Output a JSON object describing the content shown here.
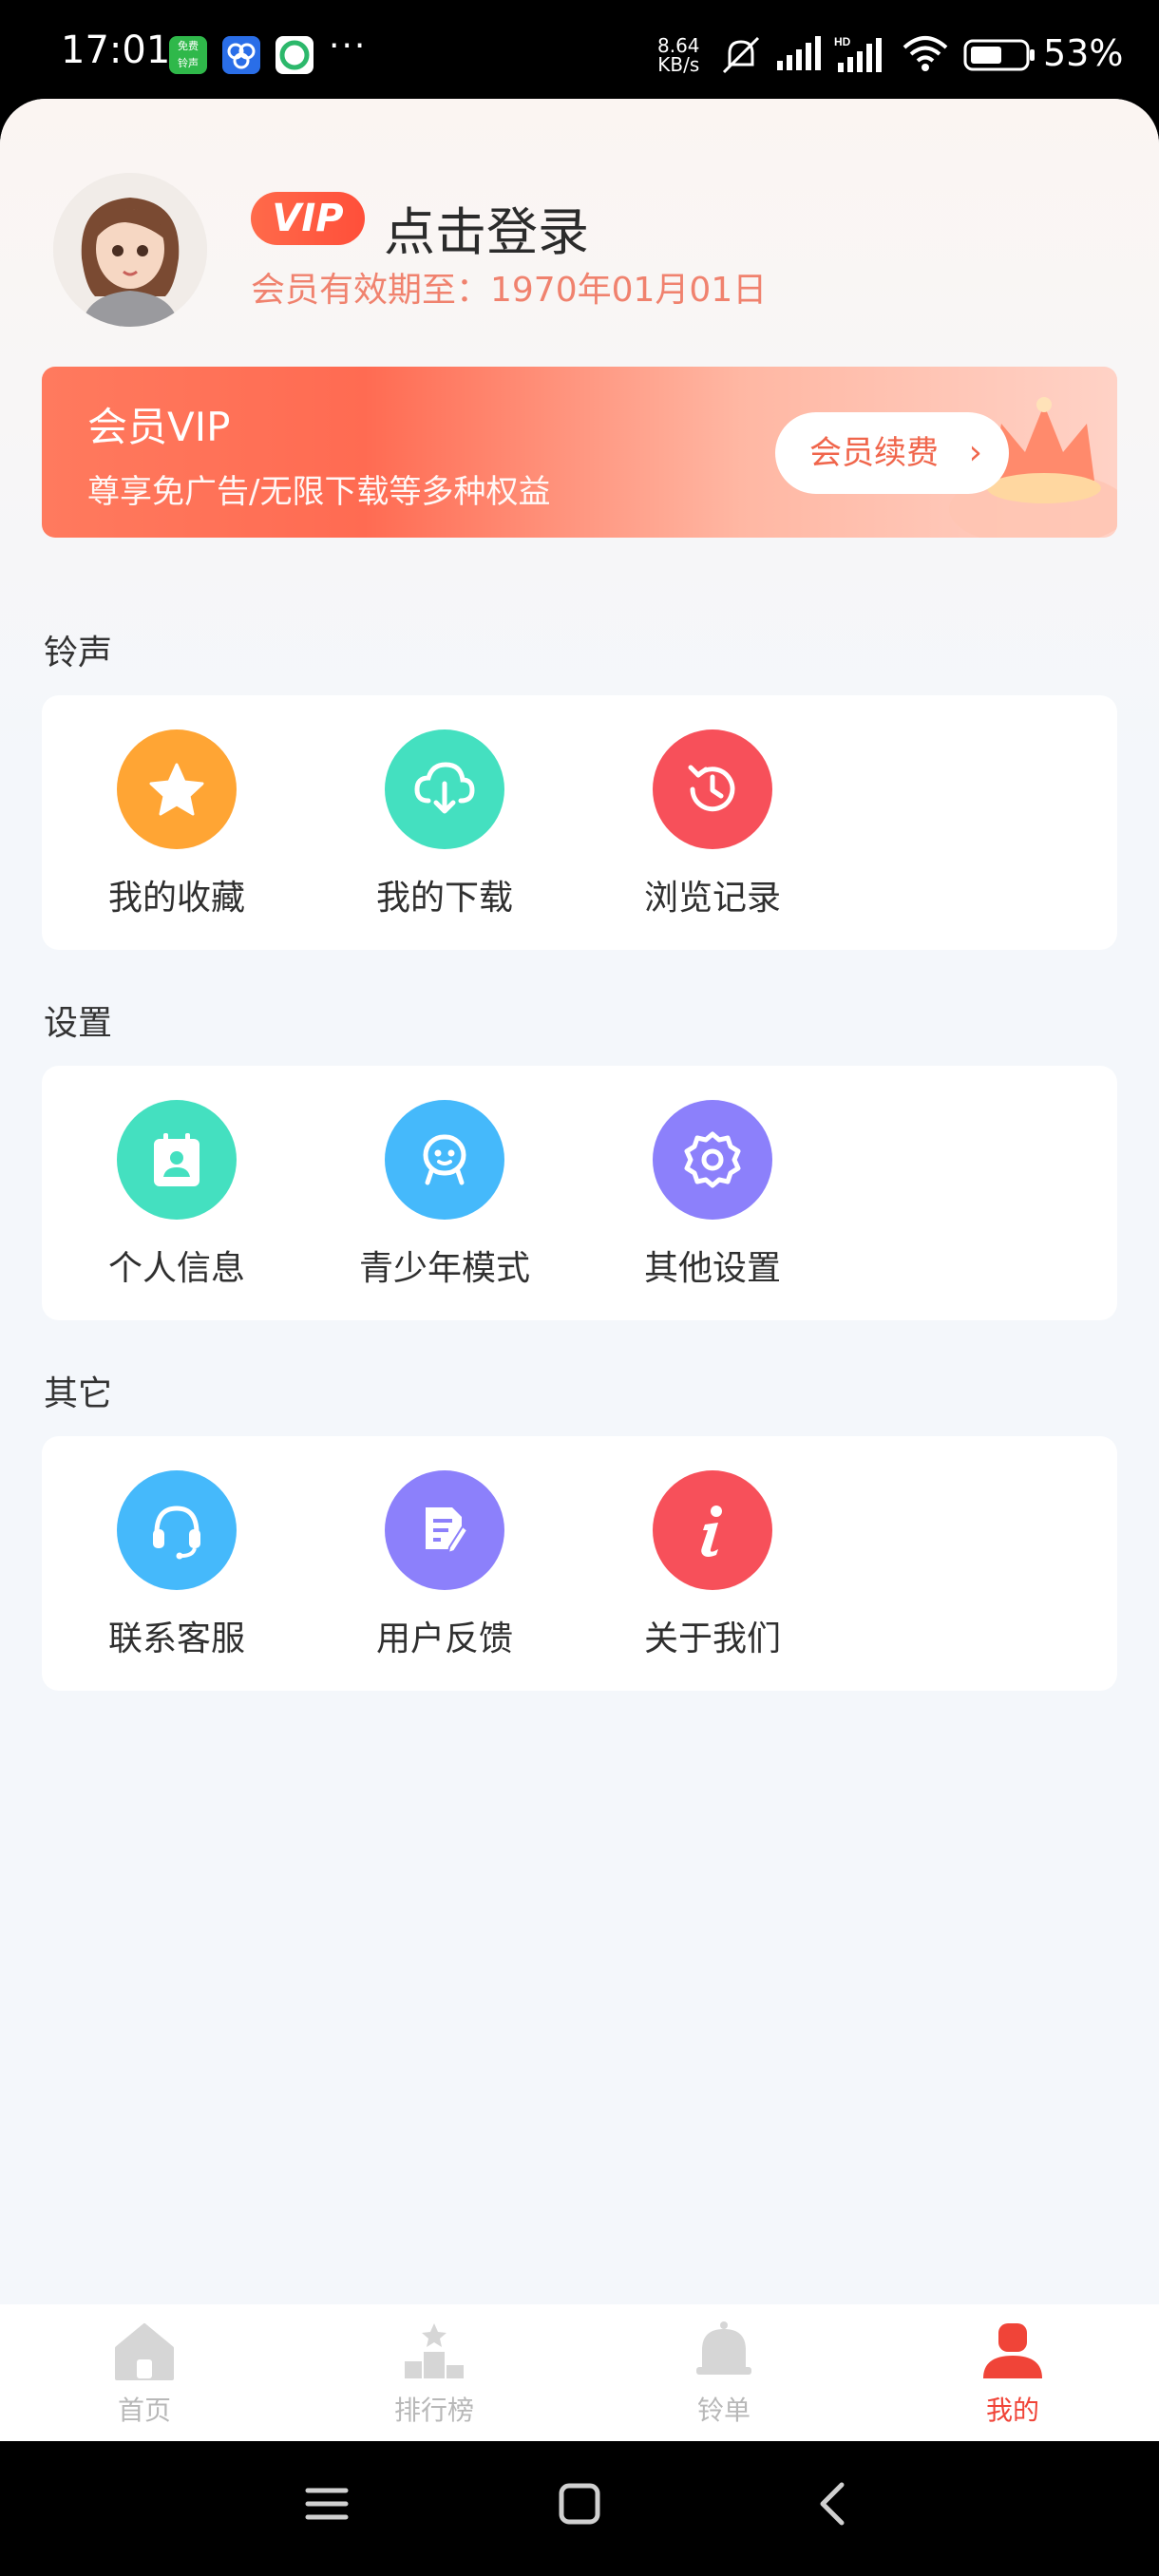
{
  "status_bar": {
    "time": "17:01",
    "app_badge_text": "免费\n铃声",
    "more": "···",
    "net_speed_value": "8.64",
    "net_speed_unit": "KB/s",
    "battery": "53%"
  },
  "profile": {
    "vip_badge": "VIP",
    "login_text": "点击登录",
    "member_expire": "会员有效期至：1970年01月01日"
  },
  "vip_card": {
    "title": "会员VIP",
    "subtitle": "尊享免广告/无限下载等多种权益",
    "renew_button": "会员续费"
  },
  "sections": [
    {
      "title": "铃声",
      "items": [
        {
          "label": "我的收藏",
          "icon": "star-icon",
          "color": "#ffa534"
        },
        {
          "label": "我的下载",
          "icon": "cloud-download-icon",
          "color": "#44e0c0"
        },
        {
          "label": "浏览记录",
          "icon": "history-icon",
          "color": "#f7505a"
        }
      ]
    },
    {
      "title": "设置",
      "items": [
        {
          "label": "个人信息",
          "icon": "contact-card-icon",
          "color": "#44e0c0"
        },
        {
          "label": "青少年模式",
          "icon": "smile-face-icon",
          "color": "#45b9fb"
        },
        {
          "label": "其他设置",
          "icon": "gear-icon",
          "color": "#8c80fb"
        }
      ]
    },
    {
      "title": "其它",
      "items": [
        {
          "label": "联系客服",
          "icon": "headset-icon",
          "color": "#45b9fb"
        },
        {
          "label": "用户反馈",
          "icon": "feedback-icon",
          "color": "#8c80fb"
        },
        {
          "label": "关于我们",
          "icon": "info-icon",
          "color": "#f7505a"
        }
      ]
    }
  ],
  "bottom_nav": {
    "items": [
      {
        "label": "首页",
        "icon": "home-icon",
        "active": false
      },
      {
        "label": "排行榜",
        "icon": "ranking-icon",
        "active": false
      },
      {
        "label": "铃单",
        "icon": "bell-icon",
        "active": false
      },
      {
        "label": "我的",
        "icon": "user-icon",
        "active": true
      }
    ]
  },
  "colors": {
    "accent": "#f04438",
    "vip_gradient_start": "#ff7a5e",
    "inactive_nav": "#b8b8b8"
  }
}
